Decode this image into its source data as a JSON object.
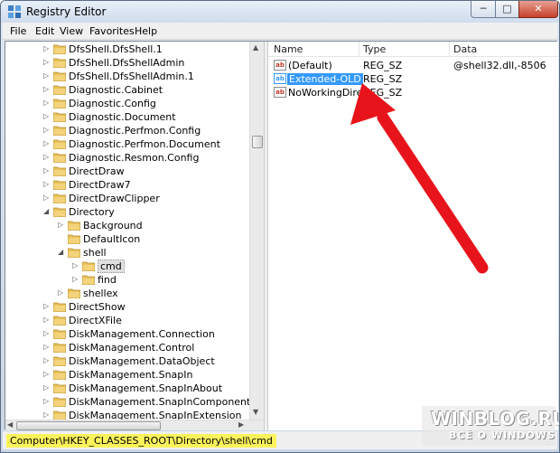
{
  "window": {
    "title": "Registry Editor",
    "buttons": {
      "minimize": "─",
      "maximize": "□",
      "close": "✕"
    }
  },
  "menu": [
    "File",
    "Edit",
    "View",
    "Favorites",
    "Help"
  ],
  "tree": {
    "items": [
      {
        "label": "DfsShell.DfsShell.1",
        "level": 0,
        "expander": "collapsed"
      },
      {
        "label": "DfsShell.DfsShellAdmin",
        "level": 0,
        "expander": "collapsed"
      },
      {
        "label": "DfsShell.DfsShellAdmin.1",
        "level": 0,
        "expander": "collapsed"
      },
      {
        "label": "Diagnostic.Cabinet",
        "level": 0,
        "expander": "collapsed"
      },
      {
        "label": "Diagnostic.Config",
        "level": 0,
        "expander": "collapsed"
      },
      {
        "label": "Diagnostic.Document",
        "level": 0,
        "expander": "collapsed"
      },
      {
        "label": "Diagnostic.Perfmon.Config",
        "level": 0,
        "expander": "collapsed"
      },
      {
        "label": "Diagnostic.Perfmon.Document",
        "level": 0,
        "expander": "collapsed"
      },
      {
        "label": "Diagnostic.Resmon.Config",
        "level": 0,
        "expander": "collapsed"
      },
      {
        "label": "DirectDraw",
        "level": 0,
        "expander": "collapsed"
      },
      {
        "label": "DirectDraw7",
        "level": 0,
        "expander": "collapsed"
      },
      {
        "label": "DirectDrawClipper",
        "level": 0,
        "expander": "collapsed"
      },
      {
        "label": "Directory",
        "level": 0,
        "expander": "expanded"
      },
      {
        "label": "Background",
        "level": 1,
        "expander": "collapsed"
      },
      {
        "label": "DefaultIcon",
        "level": 1,
        "expander": "none"
      },
      {
        "label": "shell",
        "level": 1,
        "expander": "expanded"
      },
      {
        "label": "cmd",
        "level": 2,
        "expander": "collapsed",
        "selected": true
      },
      {
        "label": "find",
        "level": 2,
        "expander": "collapsed"
      },
      {
        "label": "shellex",
        "level": 1,
        "expander": "collapsed"
      },
      {
        "label": "DirectShow",
        "level": 0,
        "expander": "collapsed"
      },
      {
        "label": "DirectXFile",
        "level": 0,
        "expander": "collapsed"
      },
      {
        "label": "DiskManagement.Connection",
        "level": 0,
        "expander": "collapsed"
      },
      {
        "label": "DiskManagement.Control",
        "level": 0,
        "expander": "collapsed"
      },
      {
        "label": "DiskManagement.DataObject",
        "level": 0,
        "expander": "collapsed"
      },
      {
        "label": "DiskManagement.SnapIn",
        "level": 0,
        "expander": "collapsed"
      },
      {
        "label": "DiskManagement.SnapInAbout",
        "level": 0,
        "expander": "collapsed"
      },
      {
        "label": "DiskManagement.SnapInComponent",
        "level": 0,
        "expander": "collapsed"
      },
      {
        "label": "DiskManagement.SnapInExtension",
        "level": 0,
        "expander": "collapsed"
      }
    ]
  },
  "values_list": {
    "columns": [
      "Name",
      "Type",
      "Data"
    ],
    "rows": [
      {
        "name": "(Default)",
        "type": "REG_SZ",
        "data": "@shell32.dll,-8506",
        "selected": false
      },
      {
        "name": "Extended-OLD",
        "type": "REG_SZ",
        "data": "",
        "selected": true
      },
      {
        "name": "NoWorkingDire...",
        "type": "REG_SZ",
        "data": "",
        "selected": false
      }
    ],
    "value_icon_text": "ab"
  },
  "annotation": {
    "arrow_color": "#e8141b"
  },
  "status": {
    "path": "Computer\\HKEY_CLASSES_ROOT\\Directory\\shell\\cmd"
  },
  "watermark": {
    "line1": "WINBLOG.RU",
    "line2": "ВСЁ О WINDOWS"
  },
  "colors": {
    "selection": "#3399ff",
    "status_highlight": "#fbf35c",
    "folder": "#e9c25a"
  }
}
